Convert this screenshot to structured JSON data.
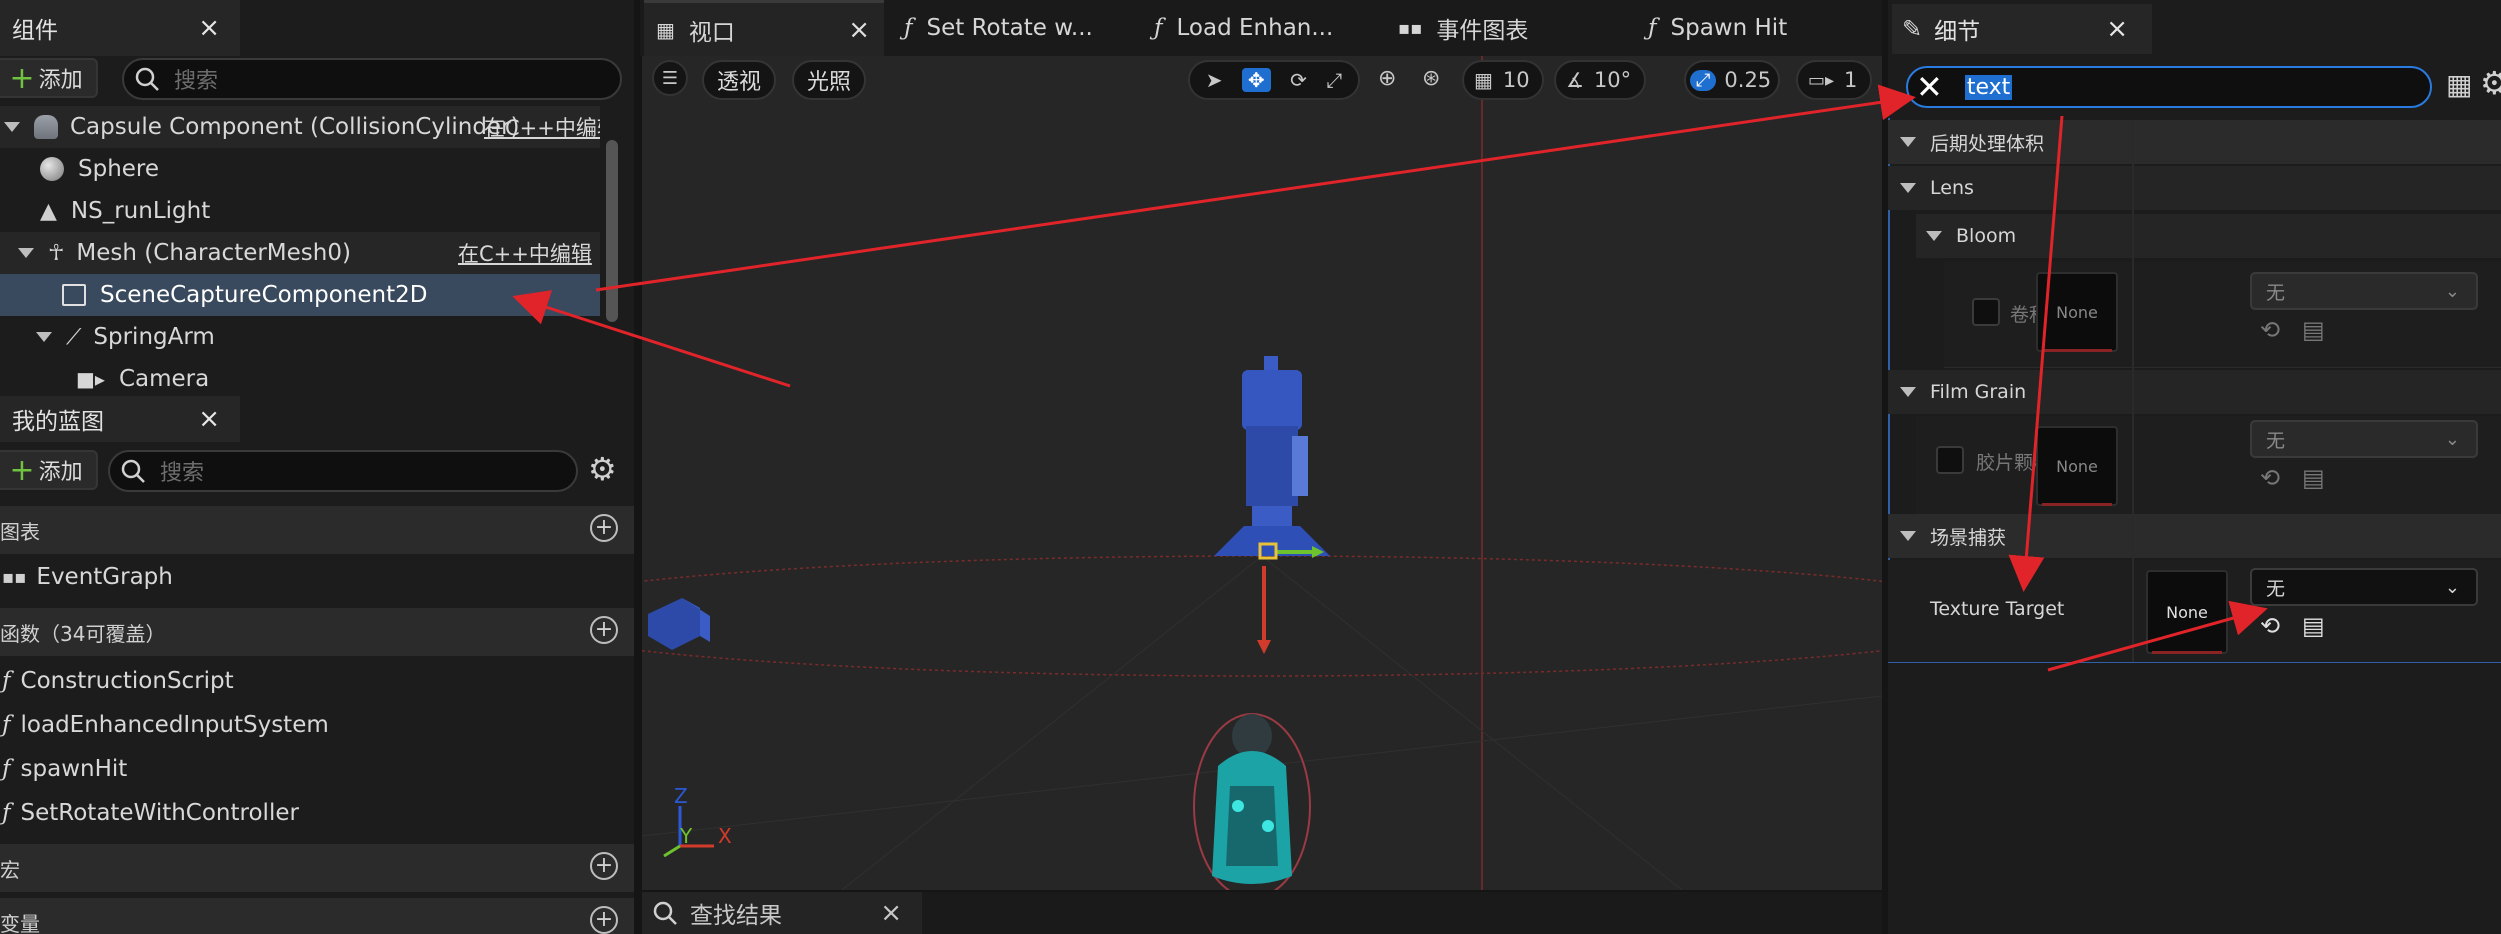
{
  "components_panel": {
    "title": "组件",
    "add_label": "添加",
    "search_placeholder": "搜索",
    "tree": [
      {
        "label": "Capsule Component (CollisionCylinder)",
        "right": "在C++中编辑"
      },
      {
        "label": "Sphere"
      },
      {
        "label": "NS_runLight"
      },
      {
        "label": "Mesh (CharacterMesh0)",
        "right": "在C++中编辑"
      },
      {
        "label": "SceneCaptureComponent2D"
      },
      {
        "label": "SpringArm"
      },
      {
        "label": "Camera"
      }
    ]
  },
  "blueprint_panel": {
    "title": "我的蓝图",
    "add_label": "添加",
    "search_placeholder": "搜索",
    "graphs_header": "图表",
    "event_graph": "EventGraph",
    "functions_header": "函数（34可覆盖）",
    "functions": [
      "ConstructionScript",
      "loadEnhancedInputSystem",
      "spawnHit",
      "SetRotateWithController"
    ],
    "macros_header": "宏",
    "variables_header": "变量"
  },
  "viewport": {
    "tabs": [
      {
        "label": "视口"
      },
      {
        "label": "Set Rotate w..."
      },
      {
        "label": "Load Enhan..."
      },
      {
        "label": "事件图表"
      },
      {
        "label": "Spawn Hit"
      }
    ],
    "perspective_label": "透视",
    "lighting_label": "光照",
    "grid_snap": "10",
    "rotation_snap": "10°",
    "scale_snap": "0.25",
    "camera_speed": "1",
    "axis_x": "X",
    "axis_y": "Y",
    "axis_z": "Z",
    "find_results_tab": "查找结果"
  },
  "details_panel": {
    "title": "细节",
    "search_value": "text",
    "sections": {
      "post_process": "后期处理体积",
      "lens": "Lens",
      "bloom": "Bloom",
      "bloom_property": "卷积核",
      "film_grain": "Film Grain",
      "film_grain_property": "胶片颗粒度纹理",
      "scene_capture": "场景捕获",
      "texture_target": "Texture Target"
    },
    "none_label": "None",
    "dropdown_value": "无"
  },
  "colors": {
    "selection": "#3a4a5e",
    "accent_blue": "#1f6fd1",
    "annotation_red": "#e0242a"
  }
}
